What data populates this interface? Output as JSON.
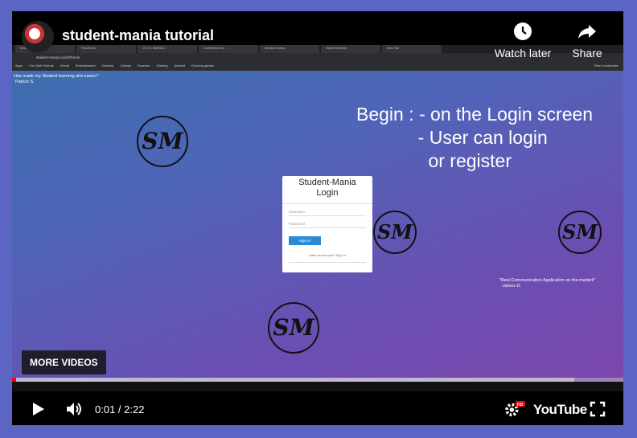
{
  "header": {
    "title": "student-mania tutorial",
    "watch_later_label": "Watch later",
    "share_label": "Share",
    "icons": [
      "clock-icon",
      "share-arrow-icon"
    ]
  },
  "browser": {
    "tabs": [
      "Inbox - Mail",
      "Facebook",
      "CS 1C MANIAC",
      "Contributors to",
      "student-mania",
      "Student-Mania",
      "New Tab"
    ],
    "address": "student-mania.com/#/home",
    "bookmarks": [
      "Apps",
      "Live Mail Outlook",
      "Social",
      "Entertainment",
      "Develop",
      "College",
      "Expense",
      "Gaming",
      "Android",
      "Develop games"
    ],
    "other_bookmarks": "Other bookmarks"
  },
  "quote_top": {
    "text": "Has made my Student learning alot easier!\"",
    "author": "Patrick S."
  },
  "quote_right": {
    "text": "\"Best Communication Application on the market!\"",
    "author": "-James D."
  },
  "caption": {
    "line1": "Begin : - on the Login screen",
    "line2": "            - User can login",
    "line3": "              or register"
  },
  "logo_text": "SM",
  "login_card": {
    "title_line1": "Student-Mania",
    "title_line2": "Login",
    "username_placeholder": "Username",
    "password_placeholder": "Password",
    "button_label": "Sign In",
    "register_text": "Have an account?",
    "register_link": "Sign in"
  },
  "more_videos_label": "MORE VIDEOS",
  "player": {
    "time": "0:01 / 2:22",
    "hd_badge": "HD",
    "brand": "YouTube",
    "played_fraction": 0.007,
    "buffered_fraction": 0.92,
    "accent_color": "#ff0000"
  }
}
